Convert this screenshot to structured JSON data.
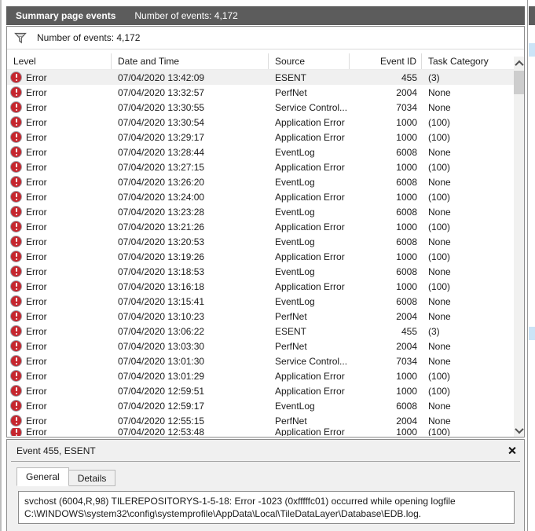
{
  "title_bar": {
    "title": "Summary page events",
    "subtitle": "Number of events: 4,172"
  },
  "filter_bar": {
    "icon": "filter-funnel-icon",
    "text": "Number of events: 4,172"
  },
  "table": {
    "columns": [
      "Level",
      "Date and Time",
      "Source",
      "Event ID",
      "Task Category"
    ],
    "rows": [
      {
        "level": "Error",
        "datetime": "07/04/2020 13:42:09",
        "source": "ESENT",
        "event_id": "455",
        "task": "(3)",
        "selected": true
      },
      {
        "level": "Error",
        "datetime": "07/04/2020 13:32:57",
        "source": "PerfNet",
        "event_id": "2004",
        "task": "None"
      },
      {
        "level": "Error",
        "datetime": "07/04/2020 13:30:55",
        "source": "Service Control...",
        "event_id": "7034",
        "task": "None"
      },
      {
        "level": "Error",
        "datetime": "07/04/2020 13:30:54",
        "source": "Application Error",
        "event_id": "1000",
        "task": "(100)"
      },
      {
        "level": "Error",
        "datetime": "07/04/2020 13:29:17",
        "source": "Application Error",
        "event_id": "1000",
        "task": "(100)"
      },
      {
        "level": "Error",
        "datetime": "07/04/2020 13:28:44",
        "source": "EventLog",
        "event_id": "6008",
        "task": "None"
      },
      {
        "level": "Error",
        "datetime": "07/04/2020 13:27:15",
        "source": "Application Error",
        "event_id": "1000",
        "task": "(100)"
      },
      {
        "level": "Error",
        "datetime": "07/04/2020 13:26:20",
        "source": "EventLog",
        "event_id": "6008",
        "task": "None"
      },
      {
        "level": "Error",
        "datetime": "07/04/2020 13:24:00",
        "source": "Application Error",
        "event_id": "1000",
        "task": "(100)"
      },
      {
        "level": "Error",
        "datetime": "07/04/2020 13:23:28",
        "source": "EventLog",
        "event_id": "6008",
        "task": "None"
      },
      {
        "level": "Error",
        "datetime": "07/04/2020 13:21:26",
        "source": "Application Error",
        "event_id": "1000",
        "task": "(100)"
      },
      {
        "level": "Error",
        "datetime": "07/04/2020 13:20:53",
        "source": "EventLog",
        "event_id": "6008",
        "task": "None"
      },
      {
        "level": "Error",
        "datetime": "07/04/2020 13:19:26",
        "source": "Application Error",
        "event_id": "1000",
        "task": "(100)"
      },
      {
        "level": "Error",
        "datetime": "07/04/2020 13:18:53",
        "source": "EventLog",
        "event_id": "6008",
        "task": "None"
      },
      {
        "level": "Error",
        "datetime": "07/04/2020 13:16:18",
        "source": "Application Error",
        "event_id": "1000",
        "task": "(100)"
      },
      {
        "level": "Error",
        "datetime": "07/04/2020 13:15:41",
        "source": "EventLog",
        "event_id": "6008",
        "task": "None"
      },
      {
        "level": "Error",
        "datetime": "07/04/2020 13:10:23",
        "source": "PerfNet",
        "event_id": "2004",
        "task": "None"
      },
      {
        "level": "Error",
        "datetime": "07/04/2020 13:06:22",
        "source": "ESENT",
        "event_id": "455",
        "task": "(3)"
      },
      {
        "level": "Error",
        "datetime": "07/04/2020 13:03:30",
        "source": "PerfNet",
        "event_id": "2004",
        "task": "None"
      },
      {
        "level": "Error",
        "datetime": "07/04/2020 13:01:30",
        "source": "Service Control...",
        "event_id": "7034",
        "task": "None"
      },
      {
        "level": "Error",
        "datetime": "07/04/2020 13:01:29",
        "source": "Application Error",
        "event_id": "1000",
        "task": "(100)"
      },
      {
        "level": "Error",
        "datetime": "07/04/2020 12:59:51",
        "source": "Application Error",
        "event_id": "1000",
        "task": "(100)"
      },
      {
        "level": "Error",
        "datetime": "07/04/2020 12:59:17",
        "source": "EventLog",
        "event_id": "6008",
        "task": "None"
      },
      {
        "level": "Error",
        "datetime": "07/04/2020 12:55:15",
        "source": "PerfNet",
        "event_id": "2004",
        "task": "None"
      },
      {
        "level": "Error",
        "datetime": "07/04/2020 12:53:48",
        "source": "Application Error",
        "event_id": "1000",
        "task": "(100)",
        "partial": true
      }
    ]
  },
  "preview": {
    "header": "Event 455, ESENT",
    "close_icon": "close-x-icon",
    "tabs": [
      {
        "label": "General",
        "active": true
      },
      {
        "label": "Details",
        "active": false
      }
    ],
    "description": "svchost (6004,R,98) TILEREPOSITORYS-1-5-18: Error -1023 (0xfffffc01) occurred while opening logfile C:\\WINDOWS\\system32\\config\\systemprofile\\AppData\\Local\\TileDataLayer\\Database\\EDB.log."
  },
  "colors": {
    "pane_header_bg": "#5c5c5c",
    "pane_header_text": "#ffffff",
    "error_icon_red": "#c5262e",
    "selected_row_bg": "#f0f0f0",
    "panel_bg": "#f0f0f0",
    "border_dark": "#8c8c8c",
    "scroll_thumb": "#cdcdcd",
    "actions_sliver_blue": "#cce4f7"
  }
}
